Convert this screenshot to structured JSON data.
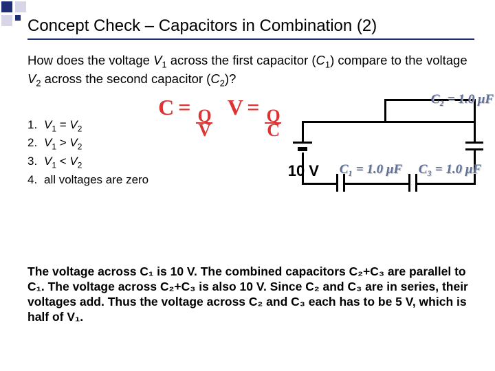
{
  "title": "Concept Check – Capacitors in Combination (2)",
  "question_prefix": "How does the voltage ",
  "question_v1": "V",
  "question_v1_sub": "1",
  "question_mid1": " across the first capacitor (",
  "question_c1": "C",
  "question_c1_sub": "1",
  "question_mid2": ") compare to the voltage ",
  "question_v2": "V",
  "question_v2_sub": "2",
  "question_mid3": " across the second capacitor (",
  "question_c2": "C",
  "question_c2_sub": "2",
  "question_end": ")?",
  "options": [
    {
      "n": "1.",
      "pre": "V",
      "ps": "1",
      "mid": " = ",
      "post": "V",
      "pps": "2"
    },
    {
      "n": "2.",
      "pre": "V",
      "ps": "1",
      "mid": " > ",
      "post": "V",
      "pps": "2"
    },
    {
      "n": "3.",
      "pre": "V",
      "ps": "1",
      "mid": " < ",
      "post": "V",
      "pps": "2"
    },
    {
      "n": "4.",
      "text": "all voltages are zero"
    }
  ],
  "hand_eq1_left": "C =",
  "hand_eq1_top": "Q",
  "hand_eq1_bot": "V",
  "hand_eq2_left": "V =",
  "hand_eq2_top": "Q",
  "hand_eq2_bot": "C",
  "source_label": "10 V",
  "cap_labels": {
    "c1": "C₁ = 1.0 μF",
    "c2": "C₂ = 1.0 μF",
    "c3": "C₃ = 1.0 μF"
  },
  "explanation": "The voltage across C₁ is 10 V.  The combined capacitors C₂+C₃ are parallel to C₁.  The voltage across C₂+C₃ is also 10 V.  Since C₂ and C₃ are in series, their voltages add.  Thus the voltage across C₂ and C₃ each has to be 5 V, which is half of V₁."
}
